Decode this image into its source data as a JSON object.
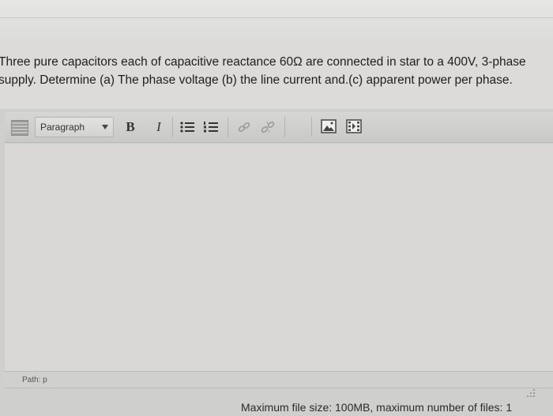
{
  "question": {
    "line1": "Three pure capacitors each of capacitive reactance 60Ω are connected in star to a 400V, 3-phase",
    "line2": "supply. Determine (a) The phase voltage (b)  the line current and.(c)  apparent power per phase."
  },
  "toolbar": {
    "format_select_value": "Paragraph",
    "bold_label": "B",
    "italic_label": "I"
  },
  "editor": {
    "path_label": "Path: p"
  },
  "footer": {
    "max_file_info": "Maximum file size: 100MB, maximum number of files: 1"
  }
}
